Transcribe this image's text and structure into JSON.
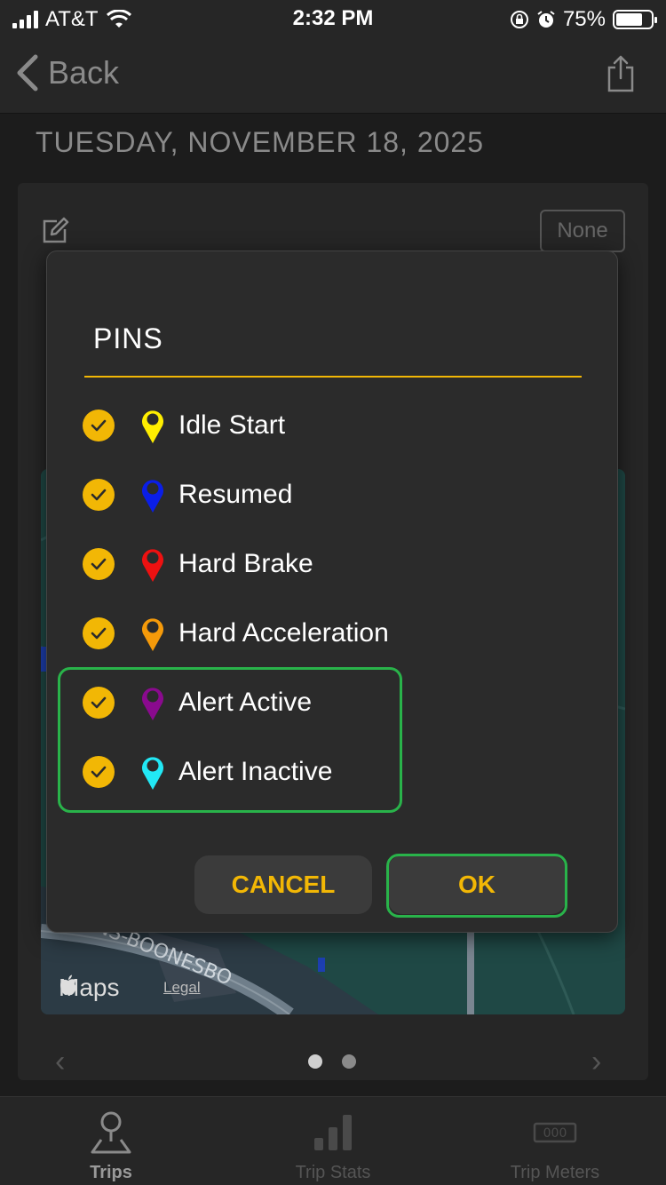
{
  "status_bar": {
    "carrier": "AT&T",
    "time": "2:32 PM",
    "battery_percent": "75%",
    "battery_level": 0.75,
    "icons": [
      "cellular-signal-icon",
      "wifi-icon",
      "orientation-lock-icon",
      "alarm-icon",
      "battery-icon"
    ]
  },
  "nav": {
    "back_label": "Back",
    "share_icon": "share-icon"
  },
  "page": {
    "date_title": "TUESDAY, NOVEMBER 18, 2025"
  },
  "card": {
    "edit_icon": "edit-icon",
    "none_label": "None",
    "map_brand": "Maps",
    "map_legal": "Legal",
    "map_road_label": "NS-BOONESBO"
  },
  "pins_dialog": {
    "title": "PINS",
    "accent_color": "#f2b705",
    "items": [
      {
        "label": "Idle Start",
        "color": "#ffee00",
        "checked": true
      },
      {
        "label": "Resumed",
        "color": "#0a1ee8",
        "checked": true
      },
      {
        "label": "Hard Brake",
        "color": "#ee1111",
        "checked": true
      },
      {
        "label": "Hard Acceleration",
        "color": "#f59a0a",
        "checked": true
      },
      {
        "label": "Alert Active",
        "color": "#8a0a8e",
        "checked": true
      },
      {
        "label": "Alert Inactive",
        "color": "#22e8f5",
        "checked": true
      }
    ],
    "cancel_label": "CANCEL",
    "ok_label": "OK"
  },
  "tabs": [
    {
      "label": "Trips",
      "icon": "trips-icon",
      "active": true
    },
    {
      "label": "Trip Stats",
      "icon": "trip-stats-icon",
      "active": false
    },
    {
      "label": "Trip Meters",
      "icon": "trip-meters-icon",
      "active": false
    }
  ]
}
